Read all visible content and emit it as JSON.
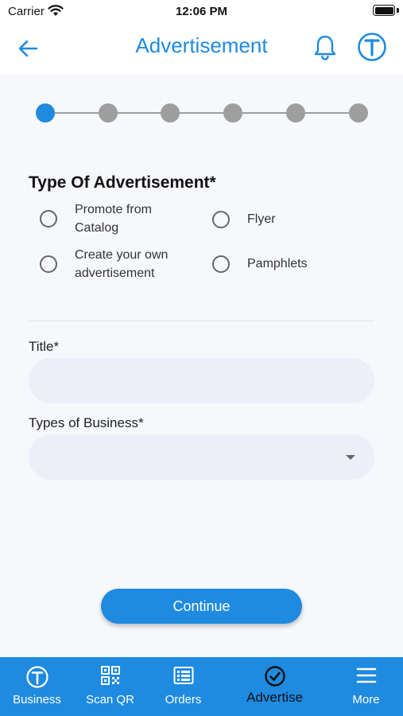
{
  "status_bar": {
    "carrier": "Carrier",
    "time": "12:06 PM"
  },
  "header": {
    "title": "Advertisement"
  },
  "stepper": {
    "total_steps": 6,
    "current_step": 1
  },
  "ad_type": {
    "title": "Type Of Advertisement*",
    "options": [
      {
        "label": "Promote from Catalog",
        "selected": false
      },
      {
        "label": "Flyer",
        "selected": false
      },
      {
        "label": "Create your own advertisement",
        "selected": false
      },
      {
        "label": "Pamphlets",
        "selected": false
      }
    ]
  },
  "form": {
    "title_label": "Title*",
    "title_value": "",
    "business_label": "Types of Business*",
    "business_value": ""
  },
  "continue_label": "Continue",
  "bottom_nav": {
    "items": [
      {
        "label": "Business",
        "icon": "business-logo-icon"
      },
      {
        "label": "Scan QR",
        "icon": "qr-code-icon"
      },
      {
        "label": "Orders",
        "icon": "list-icon"
      },
      {
        "label": "Advertise",
        "icon": "check-circle-icon",
        "active": true
      },
      {
        "label": "More",
        "icon": "menu-icon"
      }
    ]
  },
  "colors": {
    "accent": "#1e8ae0",
    "background": "#f6f8fc",
    "input_bg": "#edeff8",
    "inactive_step": "#9e9e9e"
  }
}
